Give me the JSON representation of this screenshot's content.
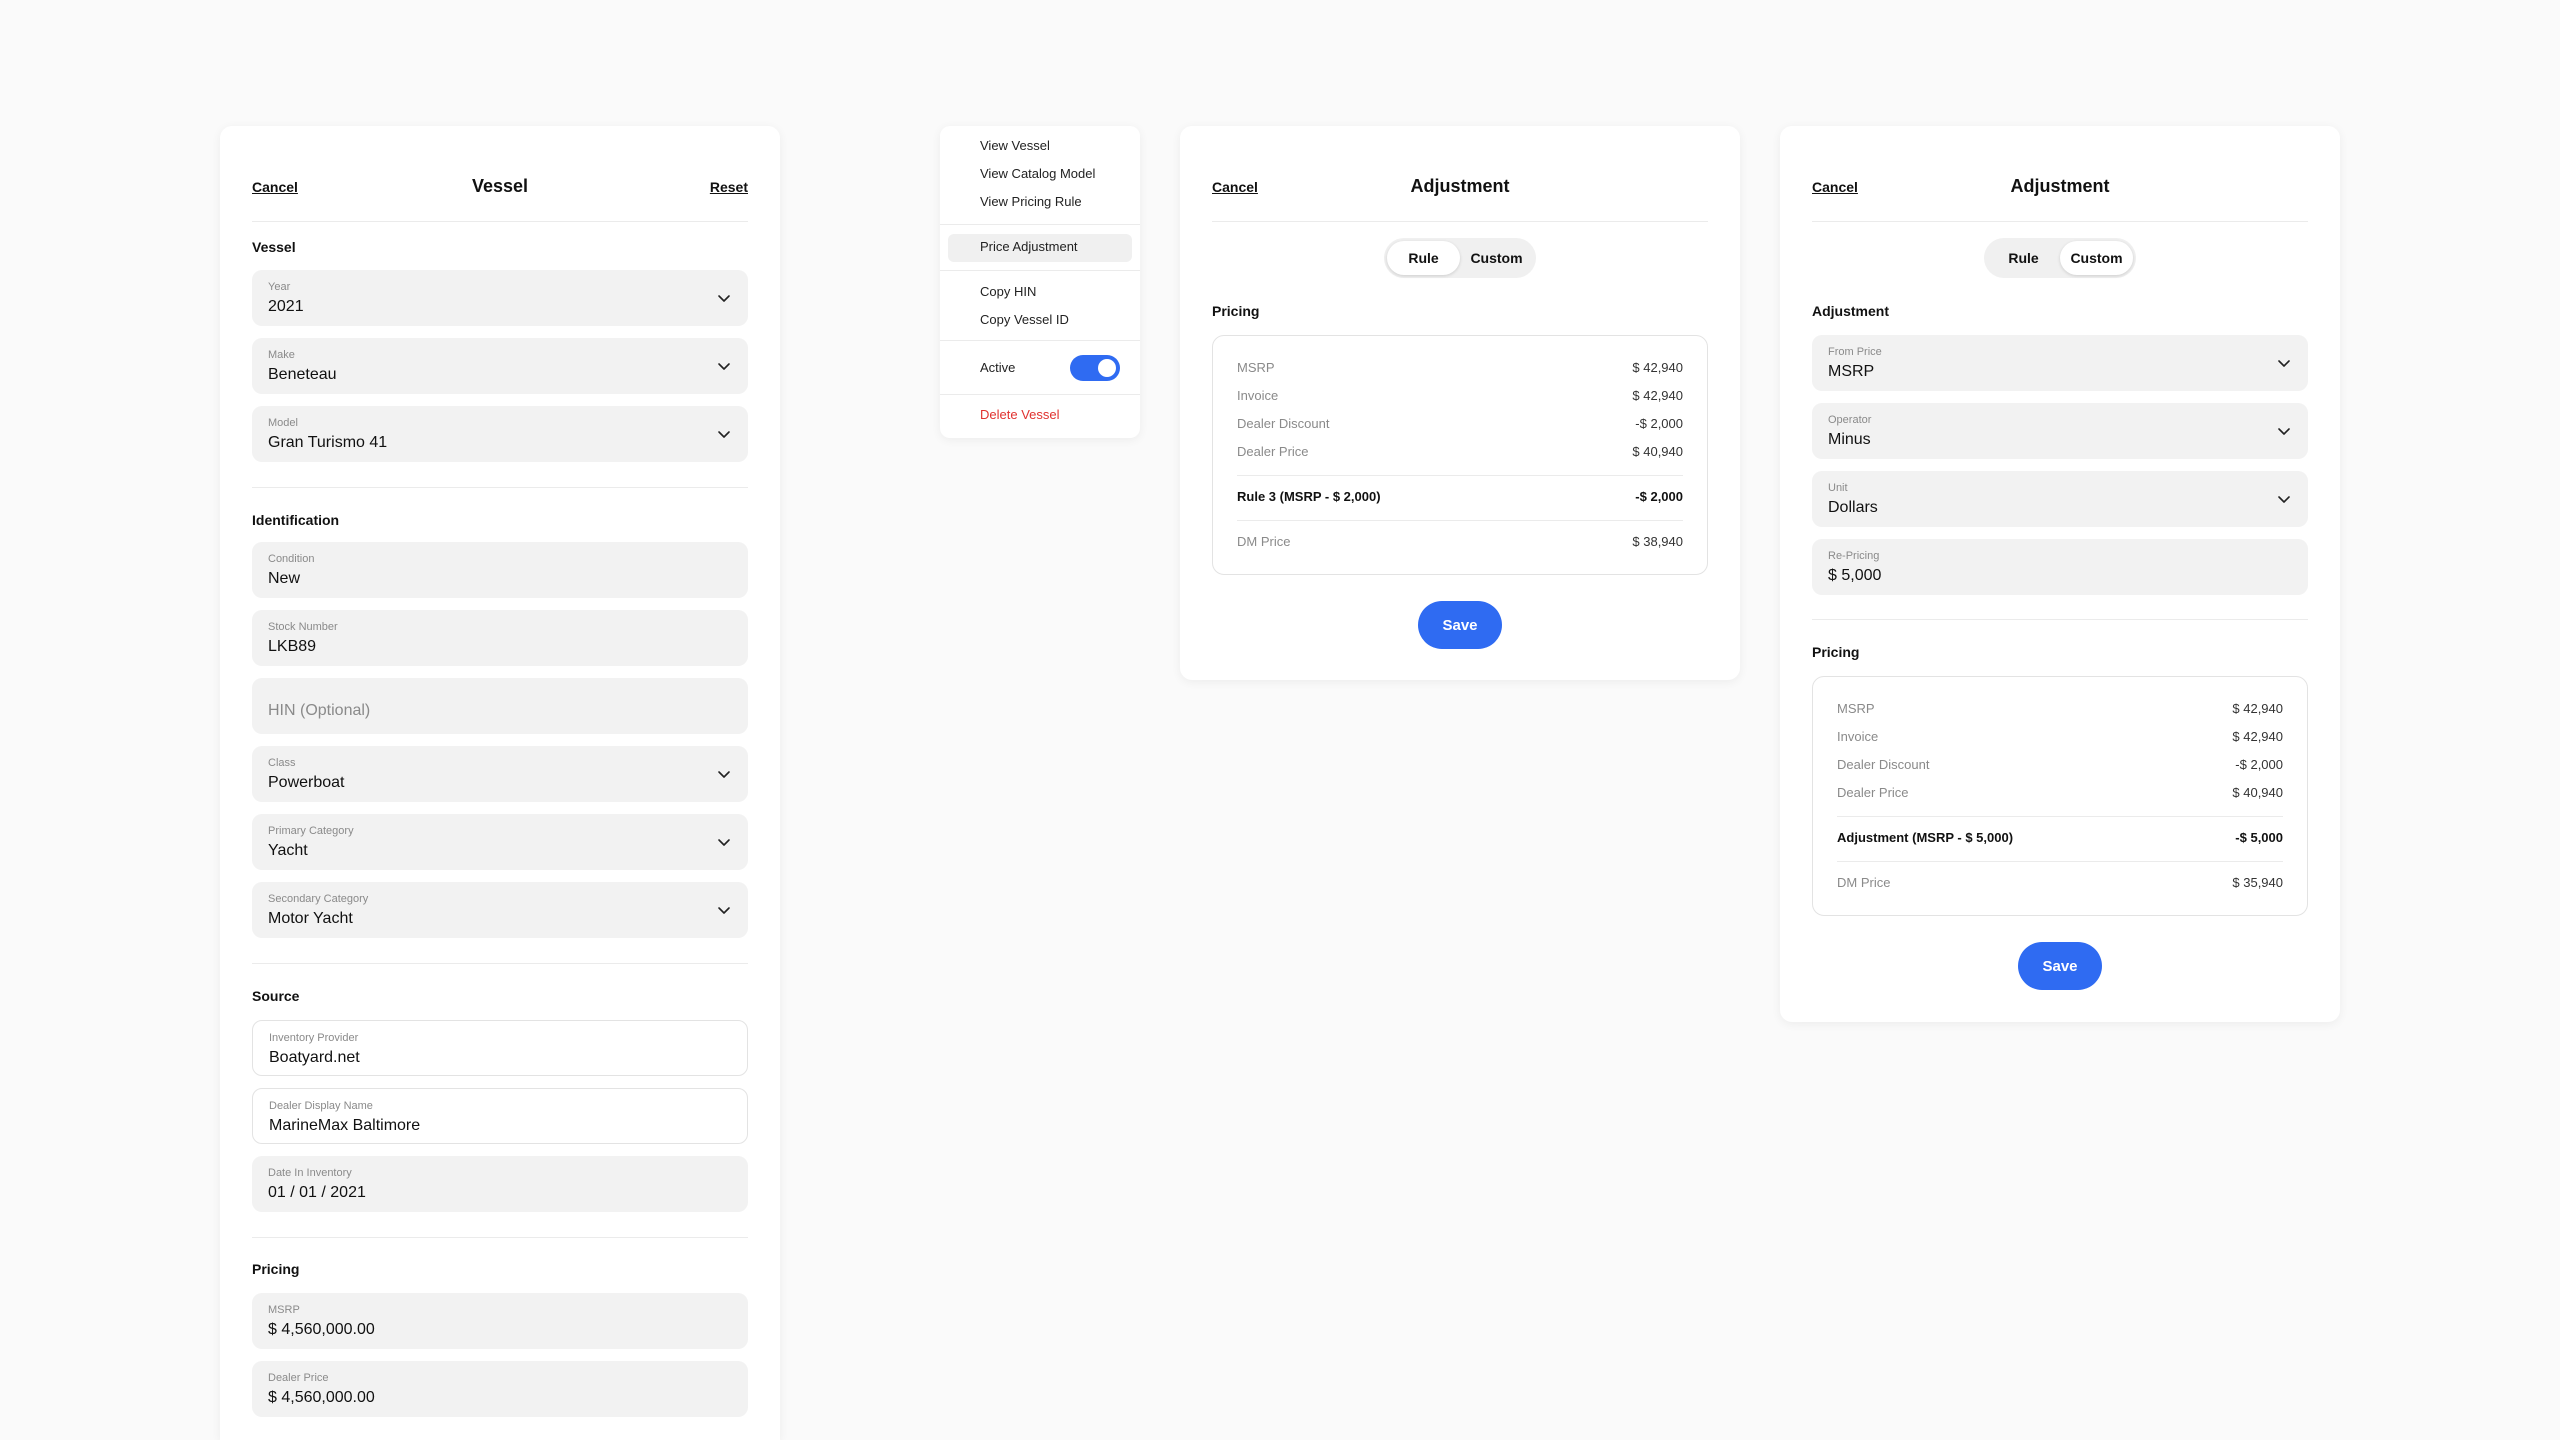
{
  "vessel_panel": {
    "cancel": "Cancel",
    "title": "Vessel",
    "reset": "Reset",
    "sections": {
      "vessel": "Vessel",
      "identification": "Identification",
      "source": "Source",
      "pricing": "Pricing"
    },
    "fields": {
      "year": {
        "label": "Year",
        "value": "2021"
      },
      "make": {
        "label": "Make",
        "value": "Beneteau"
      },
      "model": {
        "label": "Model",
        "value": "Gran Turismo 41"
      },
      "condition": {
        "label": "Condition",
        "value": "New"
      },
      "stock_number": {
        "label": "Stock Number",
        "value": "LKB89"
      },
      "hin": {
        "placeholder": "HIN (Optional)"
      },
      "class": {
        "label": "Class",
        "value": "Powerboat"
      },
      "primary_category": {
        "label": "Primary Category",
        "value": "Yacht"
      },
      "secondary_category": {
        "label": "Secondary Category",
        "value": "Motor Yacht"
      },
      "inventory_provider": {
        "label": "Inventory Provider",
        "value": "Boatyard.net"
      },
      "dealer_display_name": {
        "label": "Dealer Display Name",
        "value": "MarineMax Baltimore"
      },
      "date_in_inventory": {
        "label": "Date In Inventory",
        "value": "01 / 01 / 2021"
      },
      "msrp": {
        "label": "MSRP",
        "value": "$ 4,560,000.00"
      },
      "dealer_price": {
        "label": "Dealer Price",
        "value": "$ 4,560,000.00"
      }
    }
  },
  "context_menu": {
    "view_vessel": "View Vessel",
    "view_catalog_model": "View Catalog Model",
    "view_pricing_rule": "View Pricing Rule",
    "price_adjustment": "Price Adjustment",
    "copy_hin": "Copy HIN",
    "copy_vessel_id": "Copy Vessel ID",
    "active": "Active",
    "active_on": true,
    "delete_vessel": "Delete Vessel"
  },
  "adjust_rule": {
    "cancel": "Cancel",
    "title": "Adjustment",
    "tabs": {
      "rule": "Rule",
      "custom": "Custom"
    },
    "active_tab": "rule",
    "pricing_title": "Pricing",
    "rows": [
      {
        "label": "MSRP",
        "value": "$ 42,940"
      },
      {
        "label": "Invoice",
        "value": "$ 42,940"
      },
      {
        "label": "Dealer Discount",
        "value": "-$ 2,000"
      },
      {
        "label": "Dealer Price",
        "value": "$ 40,940"
      }
    ],
    "rule_row": {
      "label": "Rule 3 (MSRP - $ 2,000)",
      "value": "-$ 2,000"
    },
    "dm_row": {
      "label": "DM Price",
      "value": "$ 38,940"
    },
    "save": "Save"
  },
  "adjust_custom": {
    "cancel": "Cancel",
    "title": "Adjustment",
    "tabs": {
      "rule": "Rule",
      "custom": "Custom"
    },
    "active_tab": "custom",
    "adjustment_title": "Adjustment",
    "fields": {
      "from_price": {
        "label": "From Price",
        "value": "MSRP"
      },
      "operator": {
        "label": "Operator",
        "value": "Minus"
      },
      "unit": {
        "label": "Unit",
        "value": "Dollars"
      },
      "repricing": {
        "label": "Re-Pricing",
        "value": "$ 5,000"
      }
    },
    "pricing_title": "Pricing",
    "rows": [
      {
        "label": "MSRP",
        "value": "$ 42,940"
      },
      {
        "label": "Invoice",
        "value": "$ 42,940"
      },
      {
        "label": "Dealer Discount",
        "value": "-$ 2,000"
      },
      {
        "label": "Dealer Price",
        "value": "$ 40,940"
      }
    ],
    "adj_row": {
      "label": "Adjustment (MSRP - $ 5,000)",
      "value": "-$ 5,000"
    },
    "dm_row": {
      "label": "DM Price",
      "value": "$ 35,940"
    },
    "save": "Save"
  },
  "colors": {
    "accent": "#2f6bf2",
    "danger": "#e0322f"
  }
}
